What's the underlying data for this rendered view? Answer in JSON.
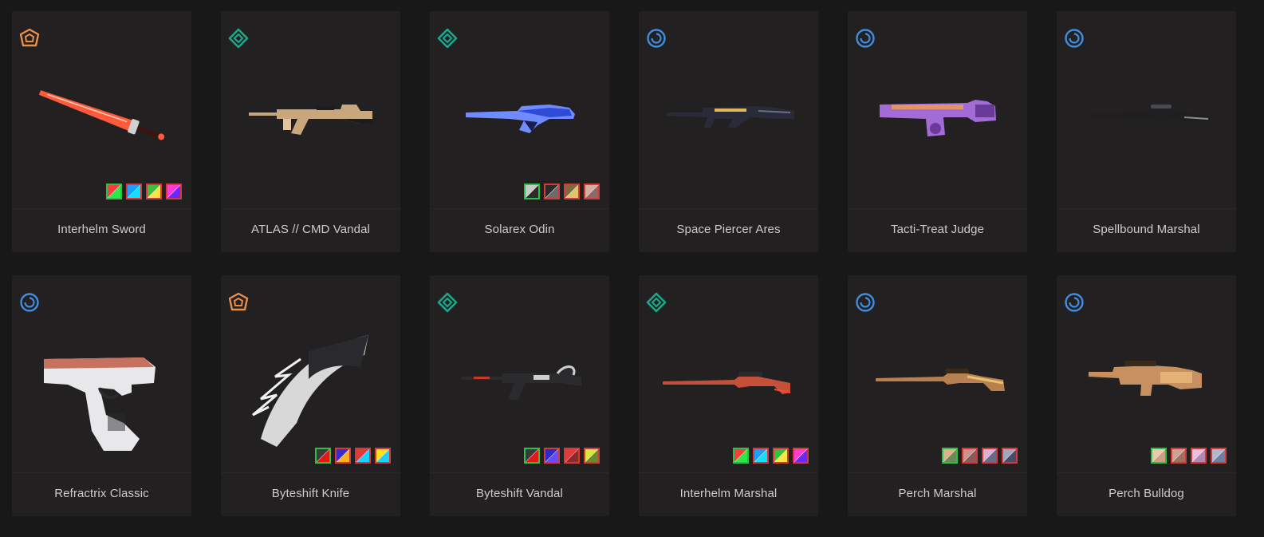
{
  "cards": [
    {
      "name": "Interhelm Sword",
      "tier": "exclusive",
      "weapon": "sword",
      "palette": [
        "#ff5a3c",
        "#3a1410",
        "#cfd0d0"
      ],
      "chromas": [
        [
          "#ff3b3b",
          "#2ee84a"
        ],
        [
          "#1aa0ff",
          "#10e0ff"
        ],
        [
          "#38c23a",
          "#ffe347"
        ],
        [
          "#ff3bd8",
          "#6a28ff"
        ]
      ]
    },
    {
      "name": "ATLAS // CMD Vandal",
      "tier": "premium",
      "weapon": "rifle",
      "palette": [
        "#c9a77e",
        "#1c1b1e",
        "#e2c49c"
      ],
      "chromas": []
    },
    {
      "name": "Solarex Odin",
      "tier": "premium",
      "weapon": "heavy",
      "palette": [
        "#2f4bd6",
        "#1a1f4a",
        "#6f8bff"
      ],
      "chromas": [
        [
          "#c8c8c8",
          "#2c2c2c"
        ],
        [
          "#2a2a2a",
          "#6b6b6b"
        ],
        [
          "#7f6a3f",
          "#e0c46a"
        ],
        [
          "#d2b0a0",
          "#8a6a6a"
        ]
      ]
    },
    {
      "name": "Space Piercer Ares",
      "tier": "deluxe",
      "weapon": "lmg",
      "palette": [
        "#2a2b38",
        "#e0b75a",
        "#6b6e90"
      ],
      "chromas": []
    },
    {
      "name": "Tacti-Treat Judge",
      "tier": "deluxe",
      "weapon": "shotgun",
      "palette": [
        "#a36bd6",
        "#f0a04a",
        "#6a3a9a"
      ],
      "chromas": []
    },
    {
      "name": "Spellbound Marshal",
      "tier": "deluxe",
      "weapon": "sniper",
      "palette": [
        "#1f1e20",
        "#4a4a4e",
        "#8b8b90"
      ],
      "chromas": []
    },
    {
      "name": "Refractrix Classic",
      "tier": "deluxe",
      "weapon": "pistol",
      "palette": [
        "#e8e8ea",
        "#c6725e",
        "#2a2a2c"
      ],
      "chromas": []
    },
    {
      "name": "Byteshift Knife",
      "tier": "exclusive",
      "weapon": "knife",
      "palette": [
        "#d8d8d8",
        "#2a2a2e",
        "#f2f2f2"
      ],
      "chromas": [
        [
          "#3a3a3a",
          "#e01818"
        ],
        [
          "#3a2ad0",
          "#ffb21a"
        ],
        [
          "#e03a3a",
          "#1ad0ff"
        ],
        [
          "#ffe31a",
          "#1ad0ff"
        ]
      ]
    },
    {
      "name": "Byteshift Vandal",
      "tier": "premium",
      "weapon": "rifle2",
      "palette": [
        "#2b2b2e",
        "#cfcfcf",
        "#c53a2a"
      ],
      "chromas": [
        [
          "#3a3a3a",
          "#e01818"
        ],
        [
          "#2a2ad0",
          "#6a4aff"
        ],
        [
          "#e03a3a",
          "#8a2a2a"
        ],
        [
          "#d8e83a",
          "#6a8a2a"
        ]
      ]
    },
    {
      "name": "Interhelm Marshal",
      "tier": "premium",
      "weapon": "sniper2",
      "palette": [
        "#c5503a",
        "#2a2a2c",
        "#ff4a2a"
      ],
      "chromas": [
        [
          "#ff3b3b",
          "#2ee84a"
        ],
        [
          "#1aa0ff",
          "#10e0ff"
        ],
        [
          "#38c23a",
          "#ffe347"
        ],
        [
          "#ff3bd8",
          "#6a28ff"
        ]
      ]
    },
    {
      "name": "Perch Marshal",
      "tier": "deluxe",
      "weapon": "sniper3",
      "palette": [
        "#b88050",
        "#e8c070",
        "#3a2a1a"
      ],
      "chromas": [
        [
          "#e0b08a",
          "#6a8a5a"
        ],
        [
          "#d0908a",
          "#8a5a5a"
        ],
        [
          "#d8b0d8",
          "#6a6a8a"
        ],
        [
          "#a0a8c0",
          "#4a4a6a"
        ]
      ]
    },
    {
      "name": "Perch Bulldog",
      "tier": "deluxe",
      "weapon": "smg",
      "palette": [
        "#c89060",
        "#f0c080",
        "#3a2a1a"
      ],
      "chromas": [
        [
          "#f0c8a8",
          "#c8a088"
        ],
        [
          "#d0a090",
          "#a07060"
        ],
        [
          "#e8c0e0",
          "#b088b0"
        ],
        [
          "#b0b8d0",
          "#7080a0"
        ]
      ]
    }
  ],
  "tier_colors": {
    "exclusive": "#e98f48",
    "premium": "#1aa88a",
    "deluxe": "#3f8ee0"
  }
}
